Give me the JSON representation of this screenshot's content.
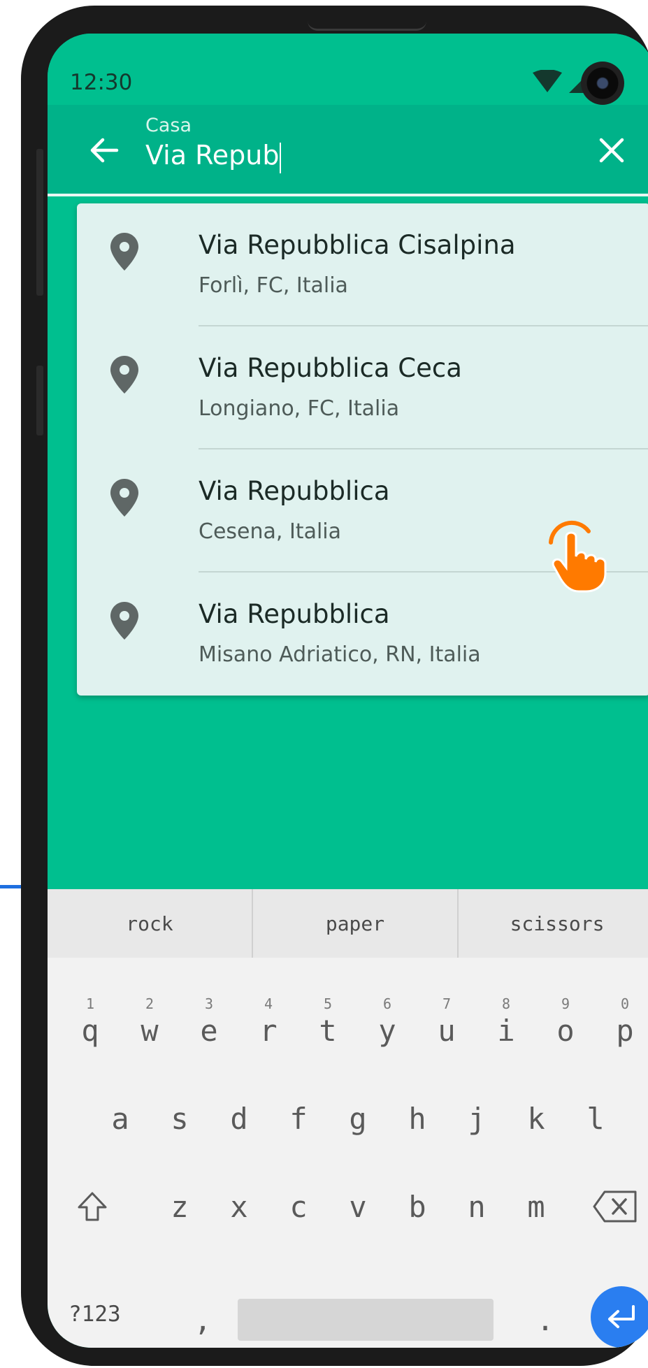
{
  "status_bar": {
    "time": "12:30"
  },
  "search": {
    "hint": "Casa",
    "value": "Via Repub"
  },
  "suggestions": [
    {
      "title": "Via Repubblica Cisalpina",
      "subtitle": "Forlì, FC, Italia"
    },
    {
      "title": "Via Repubblica Ceca",
      "subtitle": "Longiano, FC, Italia"
    },
    {
      "title": "Via Repubblica",
      "subtitle": "Cesena, Italia"
    },
    {
      "title": "Via Repubblica",
      "subtitle": "Misano Adriatico, RN, Italia"
    }
  ],
  "keyboard": {
    "suggestions": [
      "rock",
      "paper",
      "scissors"
    ],
    "row1": [
      {
        "key": "q",
        "num": "1"
      },
      {
        "key": "w",
        "num": "2"
      },
      {
        "key": "e",
        "num": "3"
      },
      {
        "key": "r",
        "num": "4"
      },
      {
        "key": "t",
        "num": "5"
      },
      {
        "key": "y",
        "num": "6"
      },
      {
        "key": "u",
        "num": "7"
      },
      {
        "key": "i",
        "num": "8"
      },
      {
        "key": "o",
        "num": "9"
      },
      {
        "key": "p",
        "num": "0"
      }
    ],
    "row2": [
      "a",
      "s",
      "d",
      "f",
      "g",
      "h",
      "j",
      "k",
      "l"
    ],
    "row3": [
      "z",
      "x",
      "c",
      "v",
      "b",
      "n",
      "m"
    ],
    "symbols_label": "?123",
    "comma": ",",
    "period": "."
  },
  "colors": {
    "app_green": "#00bf8f",
    "app_bar_green": "#00b289",
    "card_bg": "#e0f2ef",
    "enter_blue": "#2a7ef0",
    "tap_orange": "#ff7a00"
  },
  "icons": {
    "back": "arrow-left-icon",
    "clear": "close-icon",
    "pin": "location-pin-icon",
    "shift": "shift-icon",
    "backspace": "backspace-icon",
    "enter": "enter-icon",
    "tap": "tap-hand-icon"
  }
}
